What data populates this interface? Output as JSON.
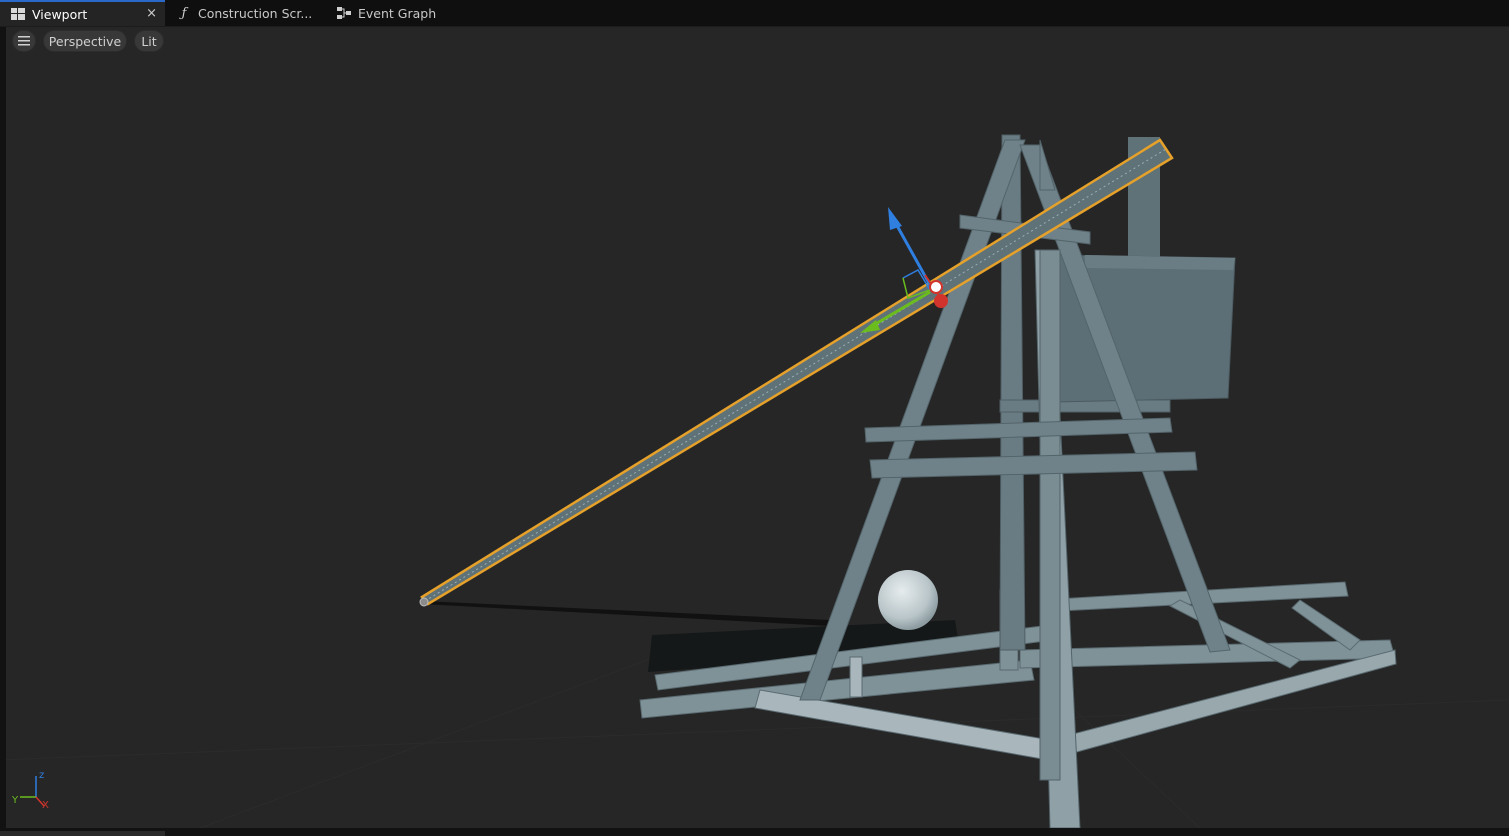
{
  "tabs": [
    {
      "label": "Viewport",
      "icon": "viewport-icon",
      "active": true,
      "close": "×"
    },
    {
      "label": "Construction Scr...",
      "icon": "function-icon",
      "active": false
    },
    {
      "label": "Event Graph",
      "icon": "graph-icon",
      "active": false
    }
  ],
  "toolbar": {
    "menu_icon": "hamburger-icon",
    "perspective_label": "Perspective",
    "lit_label": "Lit"
  },
  "axis_gizmo": {
    "z": "z",
    "y": "Y",
    "x": "X"
  },
  "colors": {
    "accent_tab": "#2a69c7",
    "selection_outline": "#e6a12a",
    "mesh": "#5d6f76",
    "mesh_light": "#a9b7bc",
    "axis_x": "#d0342c",
    "axis_y": "#6bbd1e",
    "axis_z": "#2f7fe0"
  }
}
